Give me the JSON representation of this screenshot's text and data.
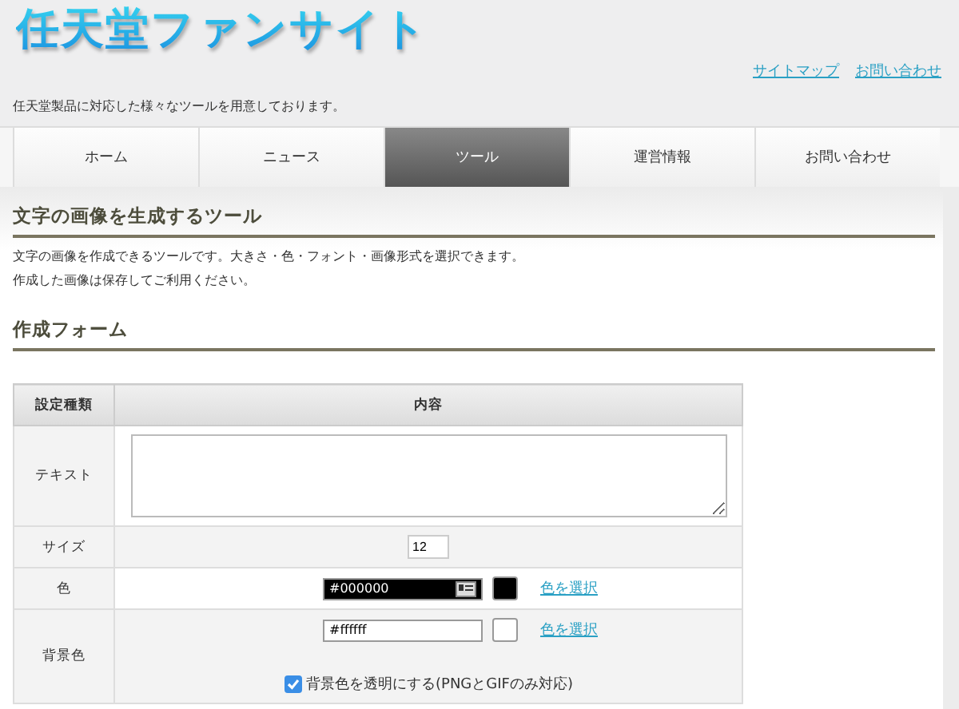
{
  "site": {
    "title": "任天堂ファンサイト",
    "tagline": "任天堂製品に対応した様々なツールを用意しております。",
    "links": [
      "サイトマップ",
      "お問い合わせ"
    ]
  },
  "nav": [
    {
      "label": "ホーム",
      "selected": false
    },
    {
      "label": "ニュース",
      "selected": false
    },
    {
      "label": "ツール",
      "selected": true
    },
    {
      "label": "運営情報",
      "selected": false
    },
    {
      "label": "お問い合わせ",
      "selected": false
    }
  ],
  "section": {
    "heading": "文字の画像を生成するツール",
    "lines": [
      "文字の画像を作成できるツールです。大きさ・色・フォント・画像形式を選択できます。",
      "作成した画像は保存してご利用ください。"
    ]
  },
  "form": {
    "heading": "作成フォーム",
    "columns": [
      "設定種類",
      "内容"
    ],
    "rows": [
      {
        "kind": "textarea",
        "label": "テキスト"
      },
      {
        "kind": "number",
        "label": "サイズ",
        "value": "12"
      },
      {
        "kind": "color",
        "label": "色",
        "value": "#000000",
        "color": "#000000",
        "link": "色を選択"
      },
      {
        "kind": "color",
        "label": "背景色",
        "value": "#ffffff",
        "color": "#ffffff",
        "link": "色を選択",
        "option": {
          "label": "背景色を透明にする(PNGとGIFのみ対応)",
          "checked": true
        }
      }
    ]
  }
}
